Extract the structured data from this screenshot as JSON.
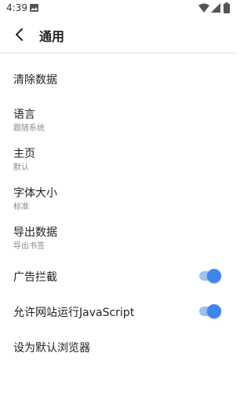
{
  "status_bar": {
    "time": "4:39"
  },
  "header": {
    "title": "通用"
  },
  "settings": [
    {
      "label": "清除数据"
    },
    {
      "label": "语言",
      "sub": "跟随系统"
    },
    {
      "label": "主页",
      "sub": "默认"
    },
    {
      "label": "字体大小",
      "sub": "标准"
    },
    {
      "label": "导出数据",
      "sub": "导出书签"
    },
    {
      "label": "广告拦截",
      "toggle": true
    },
    {
      "label": "允许网站运行JavaScript",
      "toggle": true
    },
    {
      "label": "设为默认浏览器"
    }
  ],
  "colors": {
    "accent": "#3f86ec",
    "track": "#9ec1f0"
  }
}
